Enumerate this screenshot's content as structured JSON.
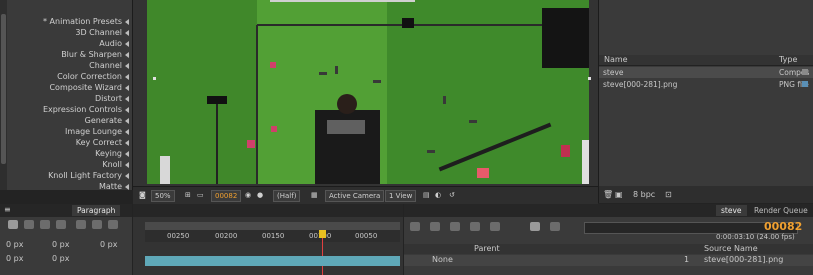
{
  "effects": {
    "items": [
      {
        "label": "* Animation Presets"
      },
      {
        "label": "3D Channel"
      },
      {
        "label": "Audio"
      },
      {
        "label": "Blur & Sharpen"
      },
      {
        "label": "Channel"
      },
      {
        "label": "Color Correction"
      },
      {
        "label": "Composite Wizard"
      },
      {
        "label": "Distort"
      },
      {
        "label": "Expression Controls"
      },
      {
        "label": "Generate"
      },
      {
        "label": "Image Lounge"
      },
      {
        "label": "Key Correct"
      },
      {
        "label": "Keying"
      },
      {
        "label": "Knoll"
      },
      {
        "label": "Knoll Light Factory"
      },
      {
        "label": "Matte"
      }
    ]
  },
  "viewer": {
    "zoom": "50%",
    "timecode": "00082",
    "resolution": "(Half)",
    "camera": "Active Camera",
    "views": "1 View"
  },
  "project": {
    "header_name": "Name",
    "header_type": "Type",
    "items": [
      {
        "name": "steve",
        "type": "Compos"
      },
      {
        "name": "steve[000-281].png",
        "type": "PNG file"
      }
    ],
    "bpc": "8 bpc"
  },
  "paragraph": {
    "tab_label": "Paragraph",
    "px_values": [
      "0 px",
      "0 px",
      "0 px",
      "0 px",
      "0 px"
    ]
  },
  "timeline": {
    "ruler": [
      "00050",
      "00100",
      "00150",
      "00200",
      "00250"
    ]
  },
  "comp": {
    "tabs": [
      {
        "label": "Render Queue"
      },
      {
        "label": "steve"
      }
    ],
    "timecode": "00082",
    "fps": "0:00:03:10 (24.00 fps)",
    "columns": {
      "source": "Source Name",
      "parent": "Parent"
    },
    "layer": {
      "name": "steve[000-281].png",
      "parent": "None",
      "index": "1"
    }
  },
  "colors": {
    "accent_orange": "#f0a030",
    "chroma_green": "#4e9a2f",
    "time_marker": "#e8c020"
  }
}
